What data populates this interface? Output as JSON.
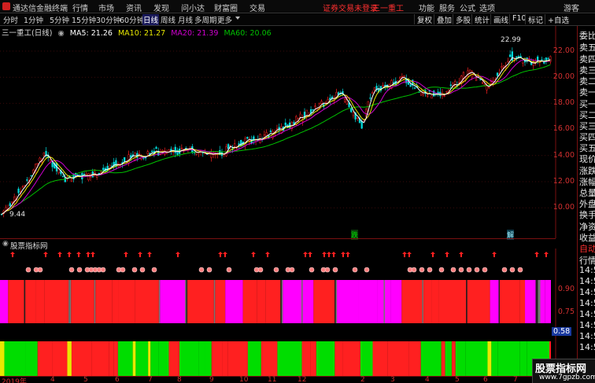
{
  "app": {
    "title": "通达信金融终端",
    "menu": [
      "行情",
      "市场",
      "资讯",
      "发现",
      "问小达",
      "财富圈",
      "交易"
    ],
    "login_notice": "证券交易未登录",
    "stock_name": "三一重工",
    "right_menu": [
      "功能",
      "服务",
      "公式",
      "选项"
    ],
    "guest": "游客"
  },
  "toolbar": {
    "periods": [
      "分时",
      "1分钟",
      "5分钟",
      "15分钟",
      "30分钟",
      "60分钟",
      "日线",
      "周线",
      "月线",
      "多周期",
      "更多"
    ],
    "active_period": "日线",
    "tools": [
      "复权",
      "叠加",
      "多股",
      "统计",
      "画线",
      "F10",
      "标记",
      "+自选"
    ]
  },
  "chart_header": {
    "symbol_label": "三一重工(日线)",
    "ma": [
      {
        "label": "MA5: 21.26",
        "color": "#ffffff"
      },
      {
        "label": "MA10: 21.27",
        "color": "#e8e800"
      },
      {
        "label": "MA20: 21.39",
        "color": "#d000d0"
      },
      {
        "label": "MA60: 20.06",
        "color": "#00c000"
      }
    ]
  },
  "price_axis": {
    "ticks": [
      "22.00",
      "20.00",
      "18.00",
      "16.00",
      "14.00",
      "12.00",
      "10.00"
    ]
  },
  "annotations": {
    "high": "22.99",
    "low": "9.44",
    "mark_1": "跌",
    "mark_2": "解"
  },
  "indicator": {
    "name": "股票指标网",
    "levels": [
      "0.90",
      "0.75",
      "0.58"
    ],
    "current_value": "0.58"
  },
  "x_axis": {
    "labels": [
      "2019年",
      "4",
      "5",
      "6",
      "7",
      "8",
      "9",
      "10",
      "11",
      "12",
      "2",
      "3",
      "4",
      "5",
      "6",
      "7",
      "8"
    ]
  },
  "right_panel": {
    "items": [
      "委比",
      "卖五",
      "卖四",
      "卖三",
      "卖二",
      "卖一",
      "买一",
      "买二",
      "买三",
      "买四",
      "买五",
      "现价",
      "涨跌",
      "涨幅",
      "总量",
      "外盘",
      "换手",
      "净资",
      "收益"
    ],
    "bottom_items": [
      "自动",
      "行情",
      "14:5",
      "14:5",
      "14:5",
      "14:5",
      "14:5",
      "14:5",
      "14:5",
      "14:5"
    ]
  },
  "watermark": {
    "text": "股票指标网",
    "url": "www.7gpzb.com"
  },
  "colors": {
    "up": "#ff2020",
    "down": "#00d8d8",
    "ma5": "#ffffff",
    "ma10": "#e8e800",
    "ma20": "#d000d0",
    "ma60": "#00c000",
    "axis": "#d23030",
    "magenta": "#ff00ff",
    "green": "#00dd00",
    "yellow": "#e8e800"
  }
}
